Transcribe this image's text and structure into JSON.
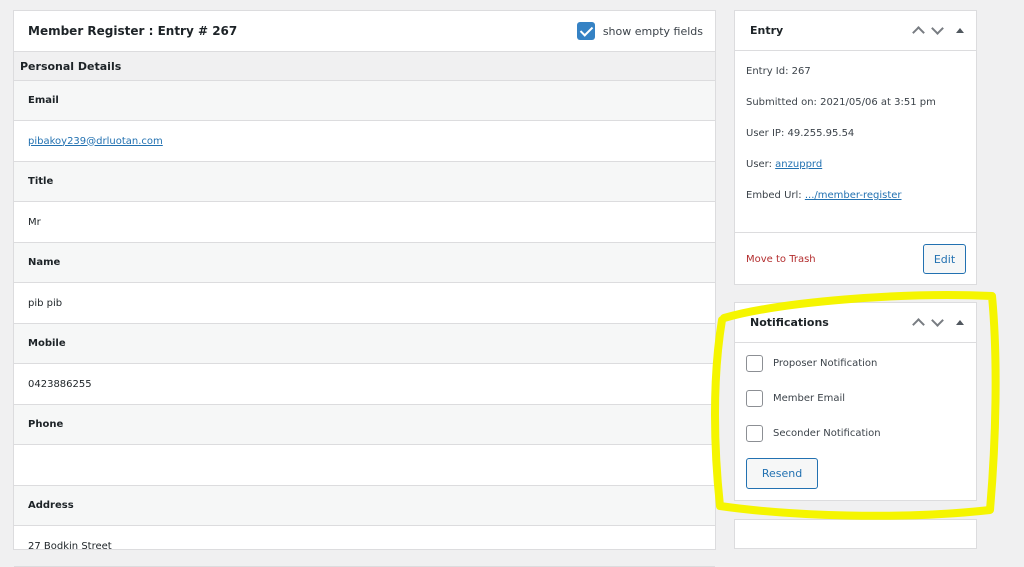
{
  "main": {
    "title": "Member Register : Entry # 267",
    "show_empty_label": "show empty fields",
    "section_title": "Personal Details",
    "fields": [
      {
        "label": "Email",
        "value": "pibakoy239@drluotan.com",
        "is_link": true
      },
      {
        "label": "Title",
        "value": "Mr"
      },
      {
        "label": "Name",
        "value": "pib pib"
      },
      {
        "label": "Mobile",
        "value": "0423886255"
      },
      {
        "label": "Phone",
        "value": ""
      },
      {
        "label": "Address",
        "value": "27 Bodkin Street"
      }
    ]
  },
  "entry": {
    "title": "Entry",
    "entry_id_label": "Entry Id: ",
    "entry_id": "267",
    "submitted_label": "Submitted on: ",
    "submitted": "2021/05/06 at 3:51 pm",
    "ip_label": "User IP: ",
    "ip": "49.255.95.54",
    "user_label": "User: ",
    "user": "anzupprd",
    "embed_label": "Embed Url: ",
    "embed": ".../member-register",
    "trash_label": "Move to Trash",
    "edit_label": "Edit"
  },
  "notifications": {
    "title": "Notifications",
    "items": [
      "Proposer Notification",
      "Member Email",
      "Seconder Notification"
    ],
    "resend_label": "Resend"
  },
  "colors": {
    "accent": "#2271b1",
    "checkbox_checked": "#3582c4",
    "trash": "#b32d2e",
    "highlight": "#f5f500"
  },
  "icons": {
    "move_up": "chevron-up-icon",
    "move_down": "chevron-down-icon",
    "toggle": "triangle-toggle-icon"
  }
}
